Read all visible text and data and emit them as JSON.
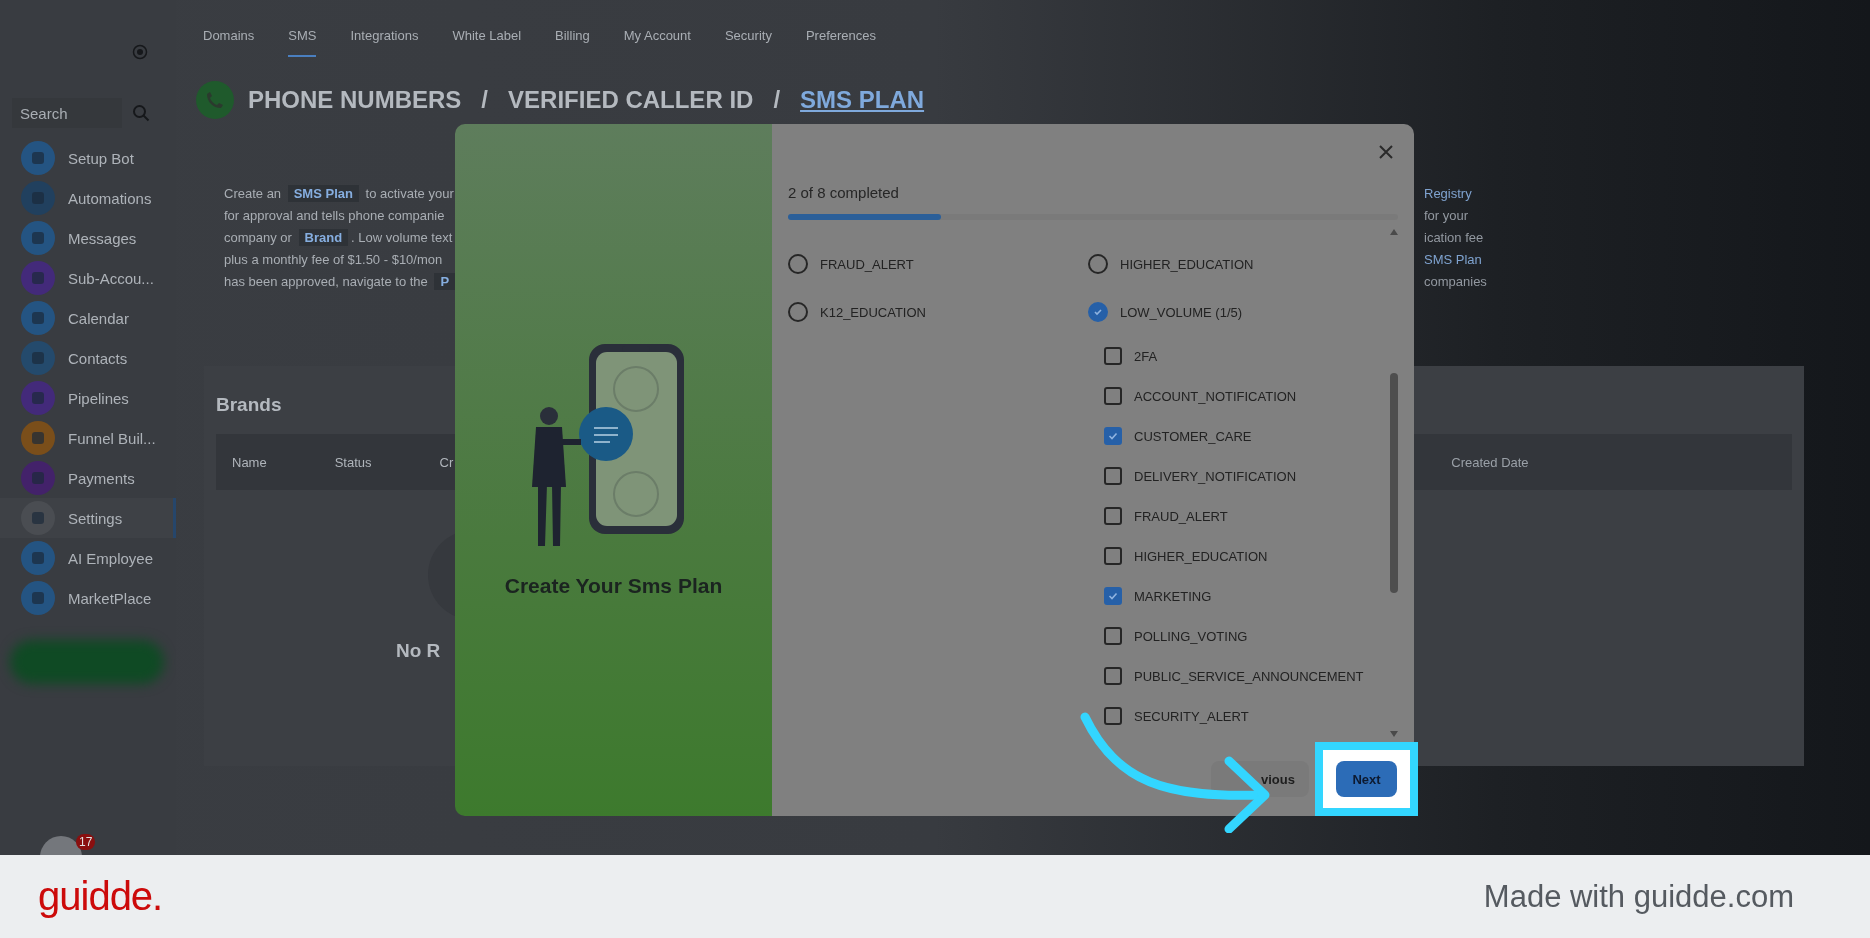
{
  "nav_tabs": [
    {
      "label": "Domains",
      "selected": false
    },
    {
      "label": "SMS",
      "selected": true
    },
    {
      "label": "Integrations",
      "selected": false
    },
    {
      "label": "White Label",
      "selected": false
    },
    {
      "label": "Billing",
      "selected": false
    },
    {
      "label": "My Account",
      "selected": false
    },
    {
      "label": "Security",
      "selected": false
    },
    {
      "label": "Preferences",
      "selected": false
    }
  ],
  "sidebar": {
    "search": {
      "placeholder": "Search"
    },
    "items": [
      {
        "label": "Setup Bot",
        "selected": false,
        "color": "#245482"
      },
      {
        "label": "Automations",
        "selected": false,
        "color": "#21405e"
      },
      {
        "label": "Messages",
        "selected": false,
        "color": "#245482"
      },
      {
        "label": "Sub-Accou...",
        "selected": false,
        "color": "#432a7a"
      },
      {
        "label": "Calendar",
        "selected": false,
        "color": "#245482"
      },
      {
        "label": "Contacts",
        "selected": false,
        "color": "#244a6c"
      },
      {
        "label": "Pipelines",
        "selected": false,
        "color": "#432a7a"
      },
      {
        "label": "Funnel Buil...",
        "selected": false,
        "color": "#7a4e1a"
      },
      {
        "label": "Payments",
        "selected": false,
        "color": "#43226a"
      },
      {
        "label": "Settings",
        "selected": true,
        "color": "#4a4d52"
      },
      {
        "label": "AI Employee",
        "selected": false,
        "color": "#245482"
      },
      {
        "label": "MarketPlace",
        "selected": false,
        "color": "#245482"
      }
    ],
    "badge": "17"
  },
  "breadcrumb": {
    "separator": "/",
    "items": [
      {
        "label": "PHONE NUMBERS",
        "kind": "plain"
      },
      {
        "label": "VERIFIED CALLER ID",
        "kind": "plain"
      },
      {
        "label": "SMS PLAN",
        "kind": "link"
      }
    ]
  },
  "description": [
    [
      {
        "text": "Create an ",
        "kind": "text"
      },
      {
        "text": "SMS Plan",
        "kind": "chip"
      },
      {
        "text": " to activate your",
        "kind": "text"
      }
    ],
    [
      {
        "text": "for approval and tells phone companie",
        "kind": "text"
      }
    ],
    [
      {
        "text": "company or ",
        "kind": "text"
      },
      {
        "text": "Brand",
        "kind": "chip"
      },
      {
        "text": ". Low volume text",
        "kind": "text"
      }
    ],
    [
      {
        "text": "plus a monthly fee of $1.50 - $10/mon",
        "kind": "text"
      }
    ],
    [
      {
        "text": "has been approved, navigate to the ",
        "kind": "text"
      },
      {
        "text": "P",
        "kind": "chip"
      }
    ]
  ],
  "description_right": [
    "Registry",
    "for your",
    "ication fee",
    "SMS Plan",
    "companies"
  ],
  "brands": {
    "title": "Brands",
    "columns": [
      "Name",
      "Status",
      "Cr"
    ],
    "column_far": "Created Date",
    "empty_text": "No R"
  },
  "modal": {
    "panel_title": "Create Your Sms Plan",
    "progress": {
      "text": "2 of 8 completed",
      "level": 0.25
    },
    "left_options": [
      {
        "label": "FRAUD_ALERT",
        "selected": false
      },
      {
        "label": "K12_EDUCATION",
        "selected": false
      }
    ],
    "right_options": [
      {
        "label": "HIGHER_EDUCATION",
        "selected": false
      },
      {
        "label": "LOW_VOLUME (1/5)",
        "selected": true,
        "children": [
          {
            "label": "2FA",
            "checked": false
          },
          {
            "label": "ACCOUNT_NOTIFICATION",
            "checked": false
          },
          {
            "label": "CUSTOMER_CARE",
            "checked": true
          },
          {
            "label": "DELIVERY_NOTIFICATION",
            "checked": false
          },
          {
            "label": "FRAUD_ALERT",
            "checked": false
          },
          {
            "label": "HIGHER_EDUCATION",
            "checked": false
          },
          {
            "label": "MARKETING",
            "checked": true
          },
          {
            "label": "POLLING_VOTING",
            "checked": false
          },
          {
            "label": "PUBLIC_SERVICE_ANNOUNCEMENT",
            "checked": false
          },
          {
            "label": "SECURITY_ALERT",
            "checked": false
          }
        ]
      }
    ],
    "buttons": [
      {
        "label": "vious",
        "kind": "secondary"
      },
      {
        "label": "Next",
        "kind": "primary"
      }
    ]
  },
  "footer": {
    "logo": "guidde.",
    "text": "Made with guidde.com"
  }
}
